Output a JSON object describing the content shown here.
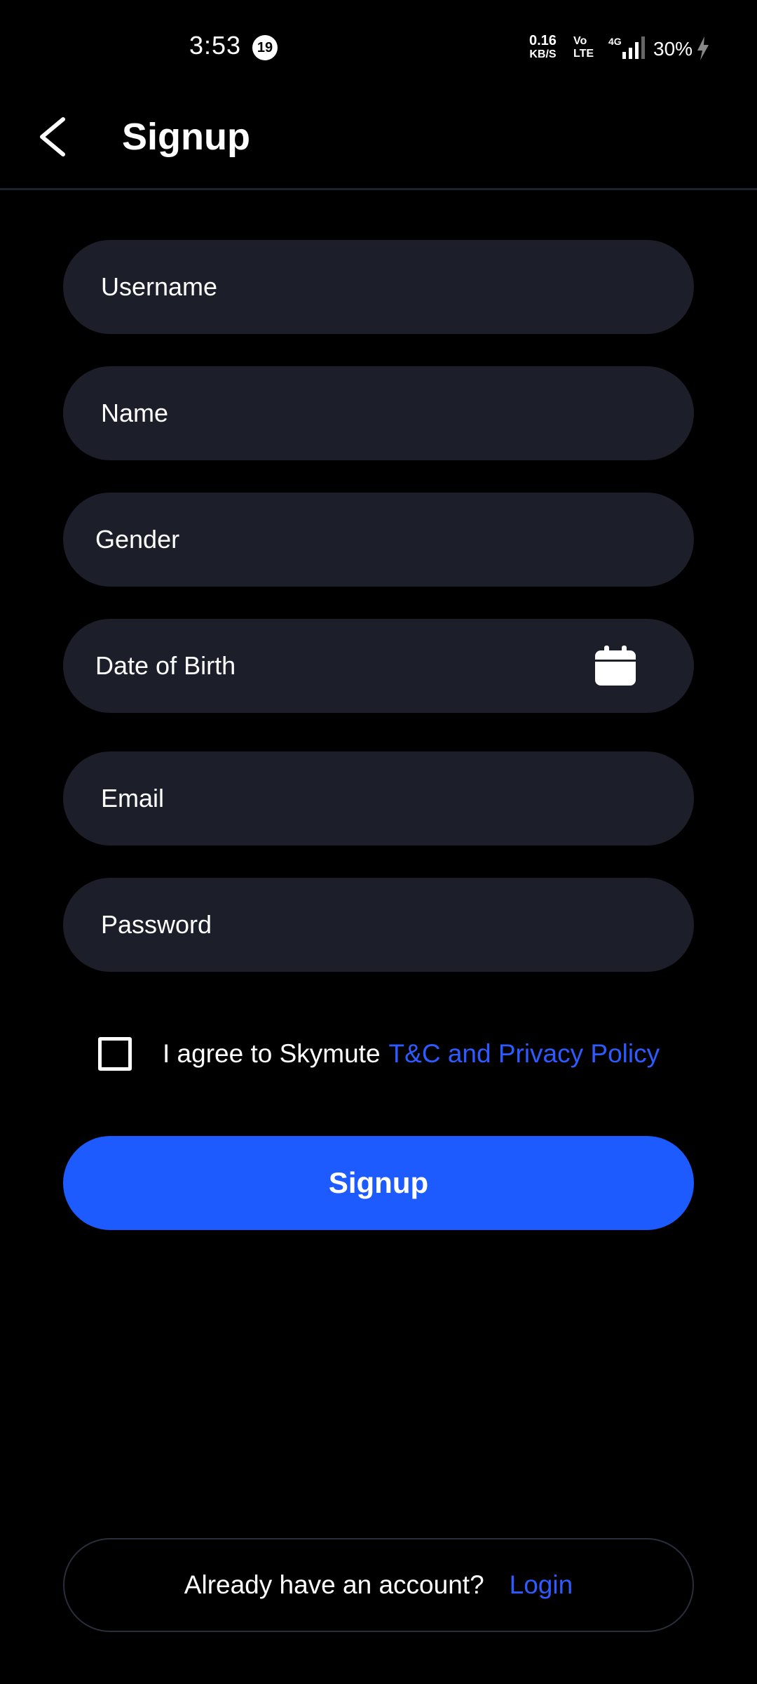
{
  "status_bar": {
    "time": "3:53",
    "notification_count": "19",
    "net_speed_value": "0.16",
    "net_speed_unit": "KB/S",
    "volte_top": "Vo",
    "volte_bottom": "LTE",
    "network": "4G",
    "battery": "30%"
  },
  "header": {
    "title": "Signup"
  },
  "form": {
    "username_placeholder": "Username",
    "name_placeholder": "Name",
    "gender_label": "Gender",
    "dob_label": "Date of Birth",
    "email_placeholder": "Email",
    "password_placeholder": "Password",
    "agree_text": "I agree to Skymute",
    "agree_link": "T&C and Privacy Policy",
    "agree_checked": false,
    "submit_label": "Signup"
  },
  "footer": {
    "question": "Already have an account?",
    "login_link": "Login"
  },
  "colors": {
    "background": "#000000",
    "field_bg": "#1c1f29",
    "accent": "#1e5bff",
    "link": "#2d5bff"
  }
}
